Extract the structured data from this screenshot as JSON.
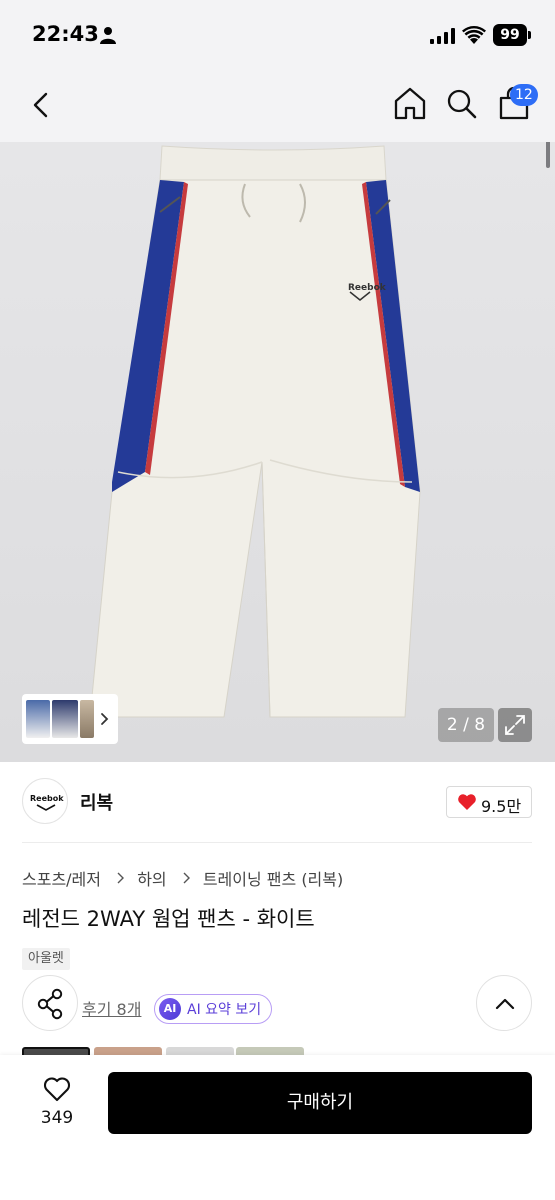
{
  "status_bar": {
    "time": "22:43",
    "battery": "99"
  },
  "header": {
    "cart_count": "12"
  },
  "gallery": {
    "page_indicator": "2 / 8"
  },
  "brand": {
    "name": "리복",
    "logo_text": "Reebok",
    "like_count": "9.5만"
  },
  "breadcrumb": [
    "스포츠/레저",
    "하의",
    "트레이닝 팬츠 (리복)"
  ],
  "product": {
    "title": "레전드 2WAY 웜업 팬츠 - 화이트",
    "tag": "아울렛",
    "printed_logo": "Reebok"
  },
  "actions": {
    "review_link": "후기 8개",
    "ai_badge": "AI",
    "ai_summary": "AI 요약 보기"
  },
  "bottom_bar": {
    "wishlist_count": "349",
    "buy_label": "구매하기"
  },
  "colors": {
    "accent": "#2d6df6",
    "heart": "#e8202a",
    "ai": "#5b3fd8",
    "pants_base": "#f1efe8",
    "pants_stripe": "#243a97"
  },
  "icons": [
    "back-icon",
    "home-icon",
    "search-icon",
    "cart-icon",
    "share-icon",
    "heart-icon",
    "chevron-up-icon",
    "expand-icon"
  ]
}
